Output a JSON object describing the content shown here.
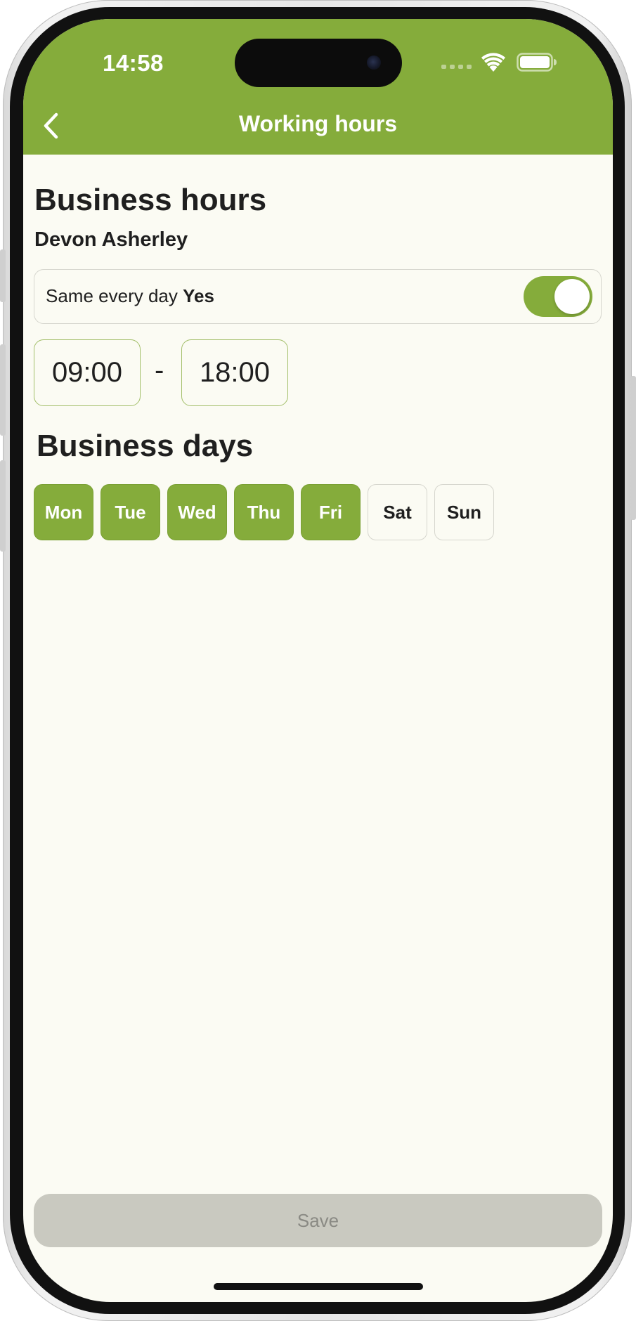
{
  "status_bar": {
    "time": "14:58",
    "signal_icon": "cellular-signal-icon",
    "wifi_icon": "wifi-icon",
    "battery_icon": "battery-icon"
  },
  "nav": {
    "back_icon": "chevron-left-icon",
    "title": "Working hours"
  },
  "business_hours": {
    "title": "Business hours",
    "person": "Devon Asherley",
    "same_every_day": {
      "label": "Same every day",
      "value": "Yes",
      "enabled": true
    },
    "start_time": "09:00",
    "separator": "-",
    "end_time": "18:00"
  },
  "business_days": {
    "title": "Business days",
    "days": [
      {
        "label": "Mon",
        "selected": true
      },
      {
        "label": "Tue",
        "selected": true
      },
      {
        "label": "Wed",
        "selected": true
      },
      {
        "label": "Thu",
        "selected": true
      },
      {
        "label": "Fri",
        "selected": true
      },
      {
        "label": "Sat",
        "selected": false
      },
      {
        "label": "Sun",
        "selected": false
      }
    ]
  },
  "save_label": "Save",
  "colors": {
    "accent": "#85ac3b",
    "background": "#fbfbf3",
    "save_disabled": "#c9c9c0"
  }
}
